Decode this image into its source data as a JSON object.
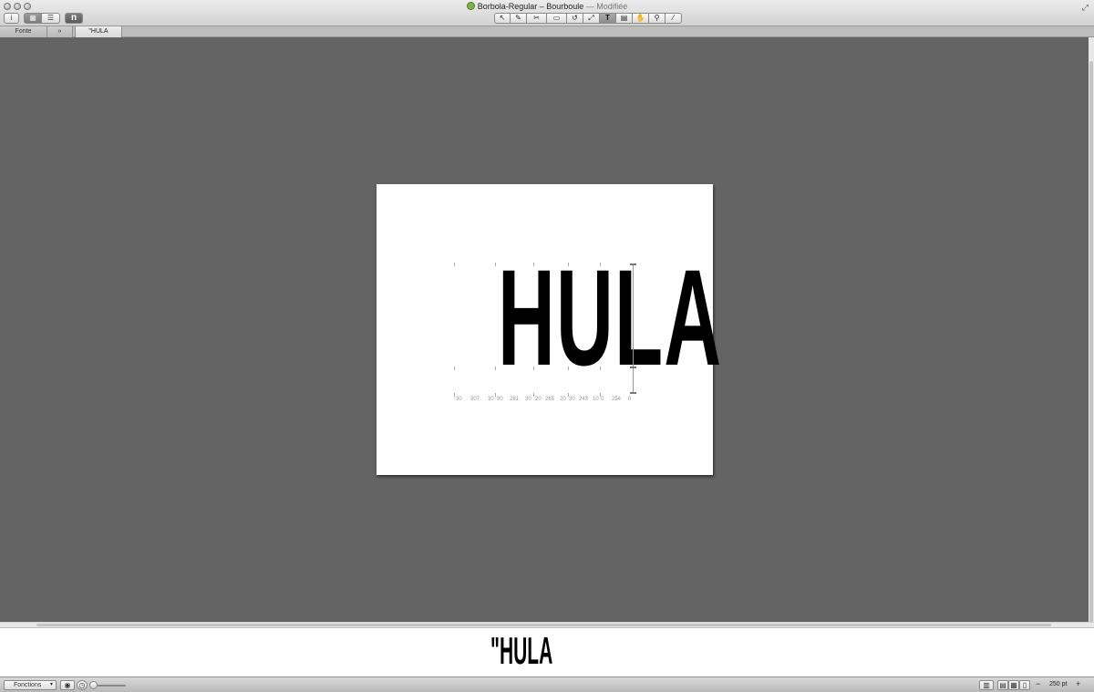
{
  "window": {
    "title": "Borbola-Regular – Bourboule",
    "status": " — Modifiée",
    "fullscreen_icon": "⤢"
  },
  "left_tools": {
    "info_label": "i",
    "view_grid": "▦",
    "view_list": "☰",
    "n_label": "n"
  },
  "center_tools": [
    {
      "icon": "pointer-icon",
      "glyph": "↖"
    },
    {
      "icon": "pen-icon",
      "glyph": "✎"
    },
    {
      "icon": "scissors-icon",
      "glyph": "✂"
    },
    {
      "icon": "rectangle-icon",
      "glyph": "▭"
    },
    {
      "icon": "rotate-icon",
      "glyph": "↺"
    },
    {
      "icon": "scale-icon",
      "glyph": "⤢"
    },
    {
      "icon": "text-icon",
      "glyph": "T"
    },
    {
      "icon": "annotation-icon",
      "glyph": "▤"
    },
    {
      "icon": "hand-icon",
      "glyph": "✋"
    },
    {
      "icon": "magnifier-icon",
      "glyph": "⚲"
    },
    {
      "icon": "measure-icon",
      "glyph": "⁄"
    }
  ],
  "tabs": [
    {
      "label": "Fonte"
    },
    {
      "label": "»"
    },
    {
      "label": "\"HULA"
    }
  ],
  "canvas": {
    "text": "HULA",
    "metrics": [
      "30",
      "307",
      "30",
      "30",
      "281",
      "30",
      "20",
      "265",
      "20",
      "30",
      "243",
      "10",
      "0",
      "254",
      "0"
    ]
  },
  "preview": {
    "text": "\"HULA"
  },
  "bottom": {
    "functions_label": "Fonctions",
    "eye_icon": "◉",
    "clock_icon": "◷",
    "zoom_minus": "−",
    "zoom_plus": "+",
    "size_label": "250 pt",
    "right_icons": [
      "▥",
      "▤",
      "▦",
      "▯"
    ]
  }
}
